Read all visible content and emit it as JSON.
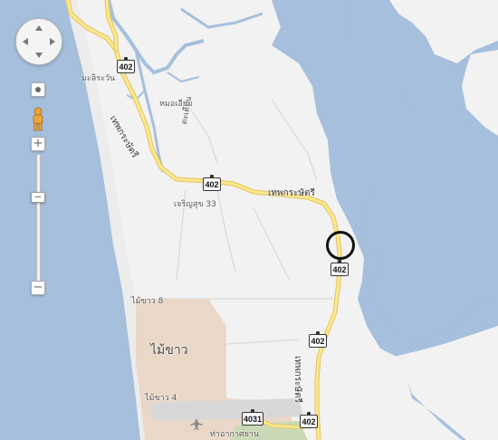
{
  "map": {
    "colors": {
      "water": "#a5bfdd",
      "land": "#f2f2f2",
      "road": "#fbe98f",
      "road_outline": "#e6c255",
      "airport": "#e9d7c7"
    },
    "labels": {
      "road_402": "402",
      "road_4031": "4031",
      "road_name_thep_kasattri": "เทพกระษัตรี",
      "village_malirawan": "มะลิระวัน",
      "village_nong_iang": "หมอเอียม",
      "village_kathu": "ตะเคียน",
      "village_chaloem_33": "เจริญสุข 33",
      "village_mai_khao_8": "ไม้ขาว 8",
      "village_mai_khao_4": "ไม้ขาว 4",
      "town_mai_khao": "ไม้ขาว",
      "airport_label": "ท่าอากาศยาน"
    }
  },
  "controls": {
    "zoom_in": "+",
    "zoom_out": "−"
  }
}
